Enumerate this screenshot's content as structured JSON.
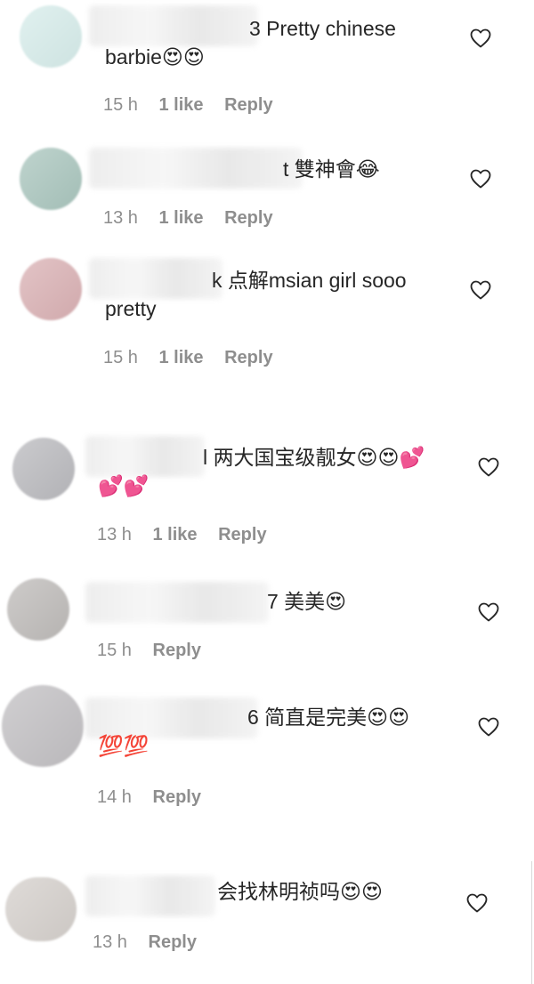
{
  "comments": [
    {
      "username": "jason_gml_3",
      "text_line1": "3 Pretty chinese",
      "text_line2": "barbie😍😍",
      "time": "15 h",
      "likes": "1 like",
      "reply": "Reply",
      "avatar_color": "#d6ecea"
    },
    {
      "username": "t",
      "text_line1": "t 雙神會😂",
      "text_line2": "",
      "time": "13 h",
      "likes": "1 like",
      "reply": "Reply",
      "avatar_color": "#a9c5bd"
    },
    {
      "username": "k",
      "text_line1": "k 点解msian girl sooo",
      "text_line2": "pretty",
      "time": "15 h",
      "likes": "1 like",
      "reply": "Reply",
      "avatar_color": "#d9b0b3"
    },
    {
      "username": "l",
      "text_line1": "l 两大国宝级靓女😍😍💕",
      "text_line2": "💕💕",
      "time": "13 h",
      "likes": "1 like",
      "reply": "Reply",
      "avatar_color": "#b9b9bd"
    },
    {
      "username": "tomchanquen_7",
      "text_line1": "7 美美😍",
      "text_line2": "",
      "time": "15 h",
      "likes": "",
      "reply": "Reply",
      "avatar_color": "#bdbab8"
    },
    {
      "username": "6",
      "text_line1": "6 简直是完美😍😍",
      "text_line2": "💯💯",
      "time": "14 h",
      "likes": "",
      "reply": "Reply",
      "avatar_color": "#c1bfc2"
    },
    {
      "username": "",
      "text_line1": "会找林明祯吗😍😍",
      "text_line2": "",
      "time": "13 h",
      "likes": "",
      "reply": "Reply",
      "avatar_color": "#d4cfcb"
    }
  ]
}
